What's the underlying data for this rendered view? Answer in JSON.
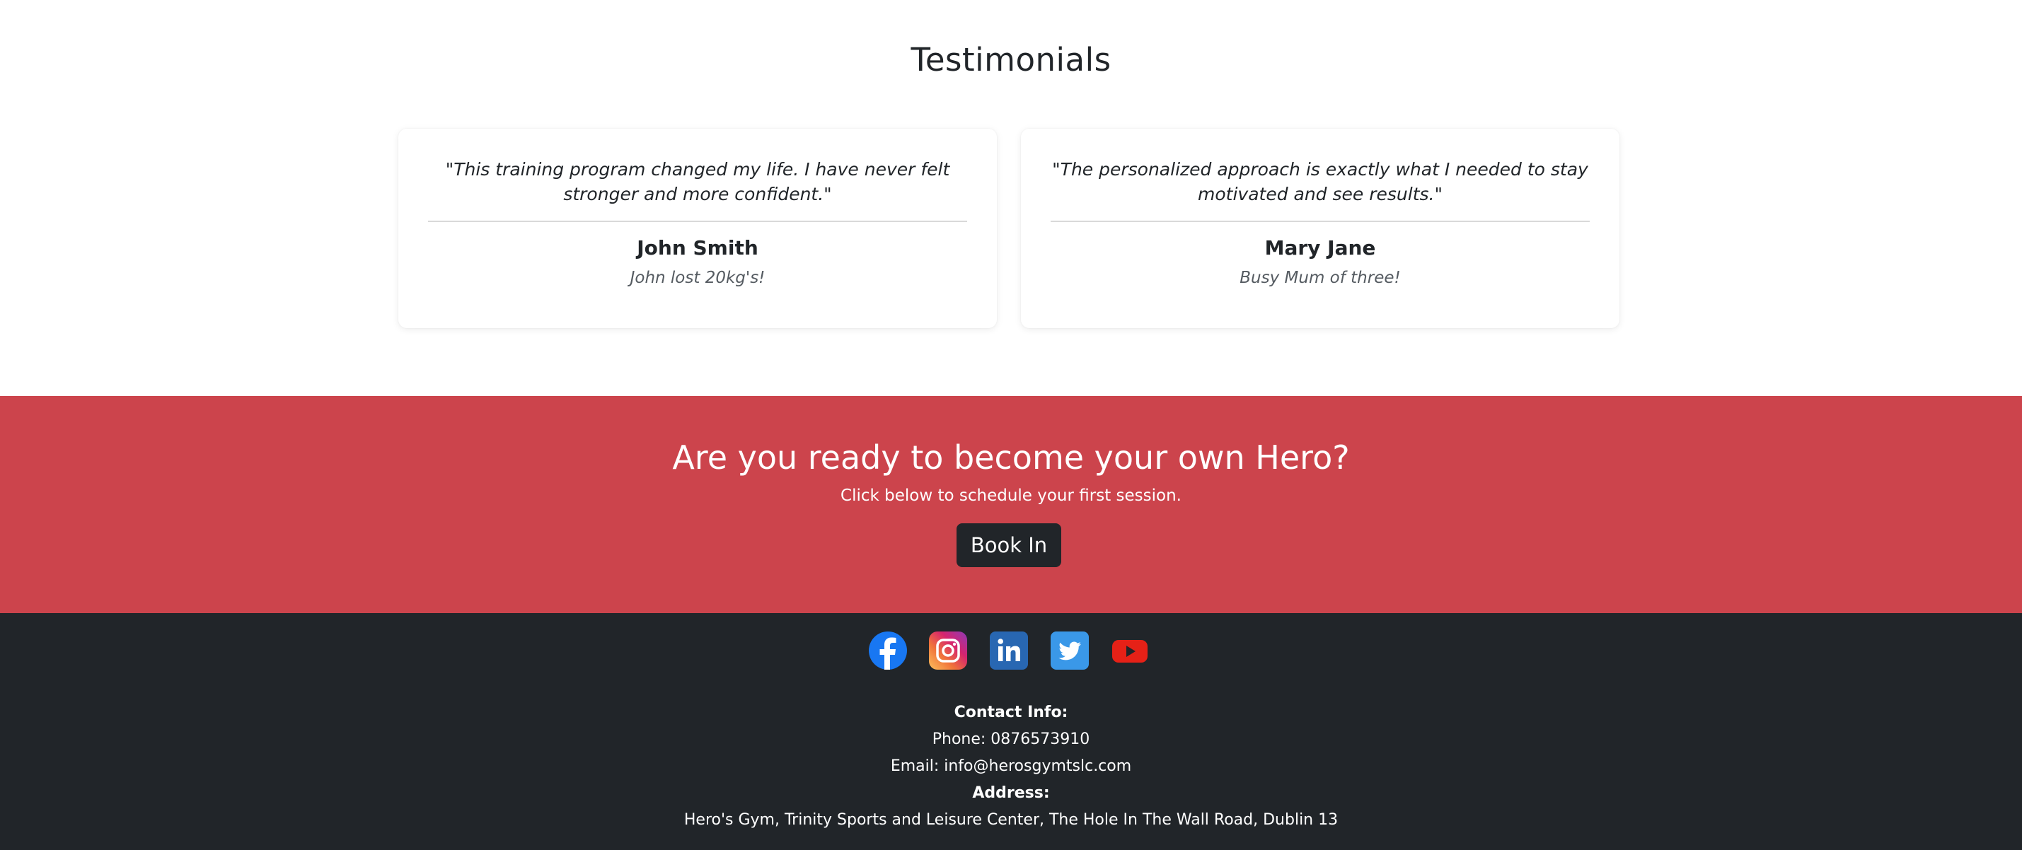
{
  "testimonials": {
    "title": "Testimonials",
    "items": [
      {
        "quote_line1": "\"This training program changed my life. I have never felt",
        "quote_line2": "stronger and more confident.\"",
        "name": "John Smith",
        "note": "John lost 20kg's!"
      },
      {
        "quote_line1": "\"The personalized approach is exactly what I needed to stay",
        "quote_line2": "motivated and see results.\"",
        "name": "Mary Jane",
        "note": "Busy Mum of three!"
      }
    ]
  },
  "cta": {
    "title": "Are you ready to become your own Hero?",
    "subtitle": "Click below to schedule your first session.",
    "button_label": "Book In"
  },
  "footer": {
    "socials": [
      {
        "icon": "facebook-icon",
        "color": "#1877f2"
      },
      {
        "icon": "instagram-icon",
        "color": "#c13584"
      },
      {
        "icon": "linkedin-icon",
        "color": "#2867b2"
      },
      {
        "icon": "twitter-icon",
        "color": "#1da1f2"
      },
      {
        "icon": "youtube-icon",
        "color": "#e62117"
      }
    ],
    "contact_heading": "Contact Info:",
    "phone": "Phone: 0876573910",
    "email": "Email: info@herosgymtslc.com",
    "address_heading": "Address:",
    "address": "Hero's Gym, Trinity Sports and Leisure Center, The Hole In The Wall Road, Dublin 13"
  },
  "colors": {
    "cta_background": "#cc444c",
    "footer_background": "#212529",
    "button_background": "#212529"
  }
}
